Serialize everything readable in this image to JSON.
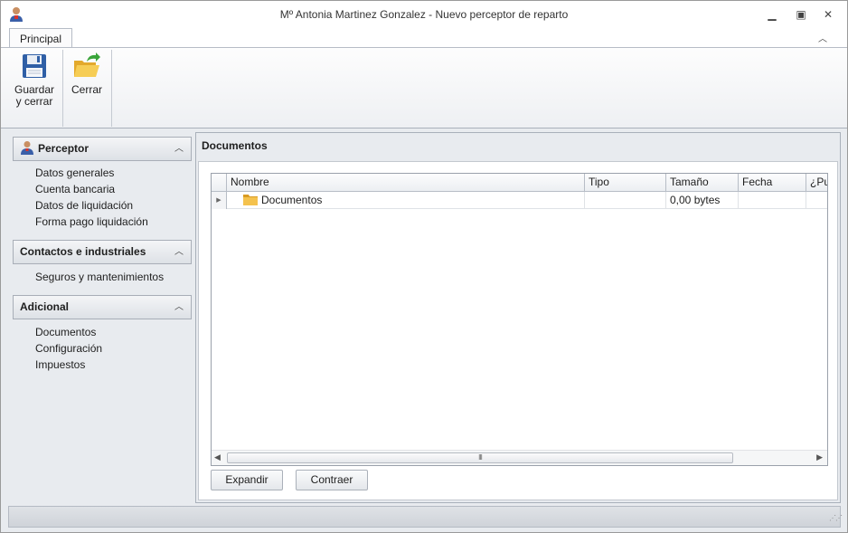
{
  "window": {
    "title": "Mº Antonia Martinez Gonzalez - Nuevo perceptor de reparto",
    "controls": [
      "minimize-icon",
      "maximize-icon",
      "close-icon"
    ]
  },
  "ribbon": {
    "tab": "Principal",
    "buttons": [
      {
        "label_line1": "Guardar",
        "label_line2": "y cerrar",
        "icon": "floppy-disk-icon"
      },
      {
        "label": "Cerrar",
        "icon": "open-folder-arrow-icon"
      }
    ]
  },
  "nav": {
    "groups": [
      {
        "title": "Perceptor",
        "icon": "user-icon",
        "items": [
          "Datos generales",
          "Cuenta bancaria",
          "Datos de liquidación",
          "Forma pago liquidación"
        ]
      },
      {
        "title": "Contactos e industriales",
        "items": [
          "Seguros y mantenimientos"
        ]
      },
      {
        "title": "Adicional",
        "items": [
          "Documentos",
          "Configuración",
          "Impuestos"
        ]
      }
    ]
  },
  "content": {
    "title": "Documentos",
    "grid": {
      "columns": [
        "Nombre",
        "Tipo",
        "Tamaño",
        "Fecha",
        "¿Pul"
      ],
      "rows": [
        {
          "nombre": "Documentos",
          "tipo": "",
          "tamano": "0,00 bytes",
          "fecha": "",
          "pub": ""
        }
      ],
      "scroll_grip": "III"
    },
    "buttons": {
      "expand": "Expandir",
      "collapse": "Contraer"
    }
  },
  "colors": {
    "accent": "#e8ebef",
    "folder": "#f4c24e"
  }
}
